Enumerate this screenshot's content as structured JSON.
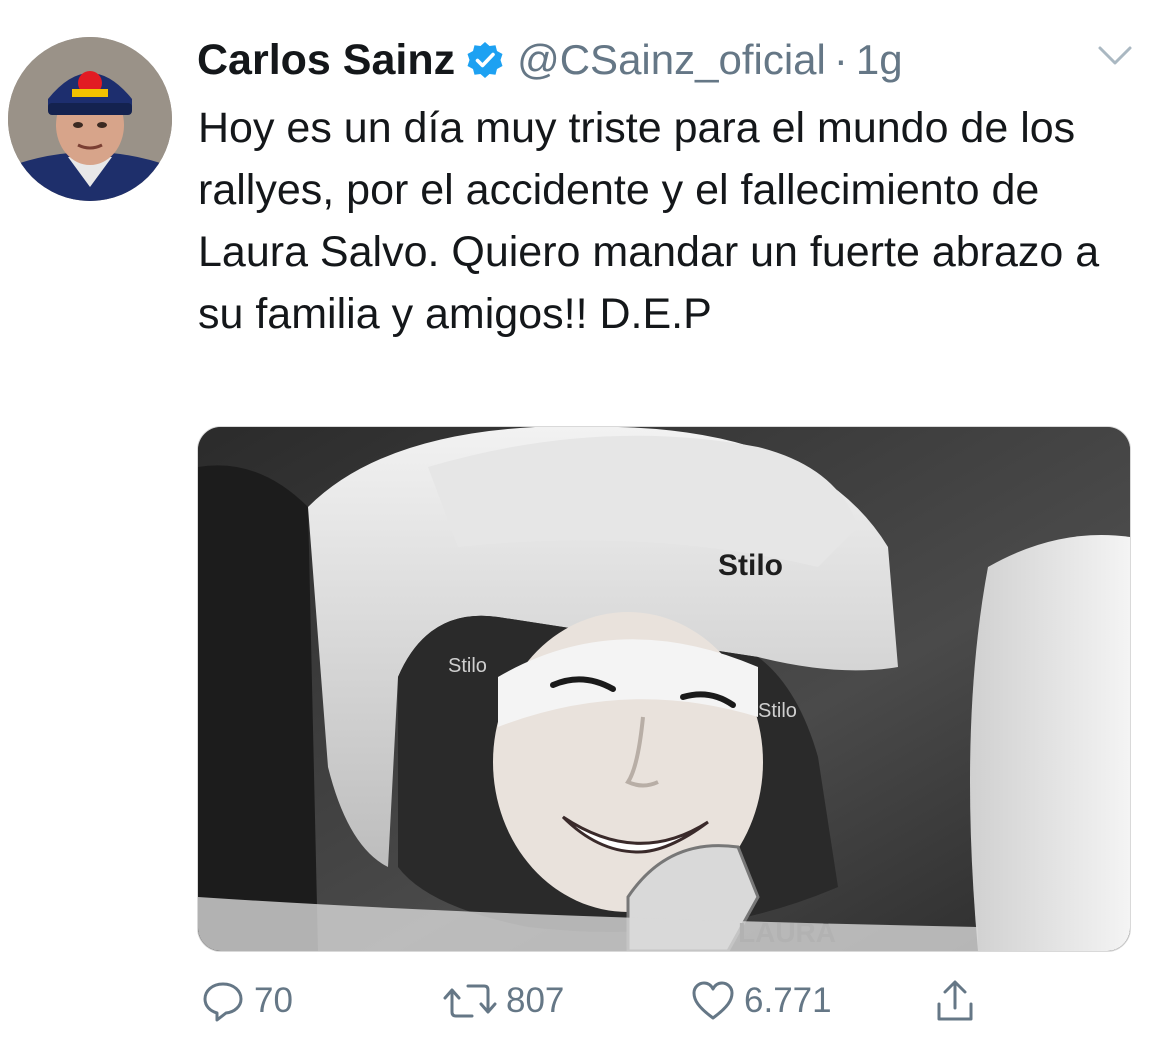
{
  "tweet": {
    "author_name": "Carlos Sainz",
    "handle": "@CSainz_oficial",
    "separator": "·",
    "time": "1g",
    "text": "Hoy es un día muy triste para el mundo de los rallyes, por el accidente y el fallecimiento de Laura Salvo. Quiero mandar un fuerte abrazo a su familia y amigos!! D.E.P"
  },
  "media": {
    "helmet_brand": "Stilo",
    "helmet_name_partial": "LAURA"
  },
  "actions": {
    "replies": "70",
    "retweets": "807",
    "likes": "6.771"
  },
  "colors": {
    "verified": "#1da1f2",
    "secondary_text": "#657786",
    "primary_text": "#14171a"
  },
  "icons": {
    "reply": "reply-icon",
    "retweet": "retweet-icon",
    "like": "heart-icon",
    "share": "share-icon",
    "more": "chevron-down-icon",
    "verified": "verified-badge-icon"
  }
}
